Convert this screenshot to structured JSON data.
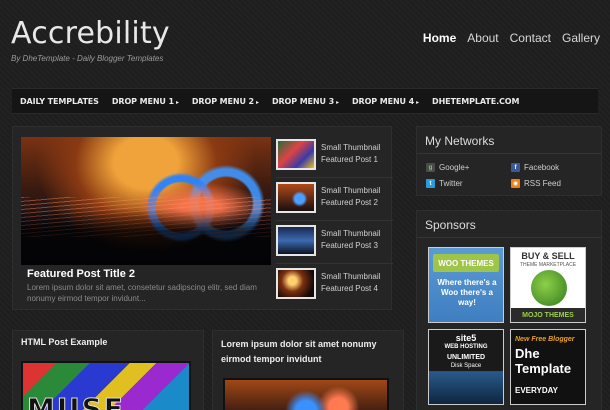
{
  "header": {
    "title": "Accrebility",
    "description": "By DheTemplate - Daily Blogger Templates",
    "nav": [
      "Home",
      "About",
      "Contact",
      "Gallery"
    ]
  },
  "menu": {
    "items": [
      {
        "label": "DAILY TEMPLATES",
        "dropdown": false
      },
      {
        "label": "DROP MENU 1",
        "dropdown": true
      },
      {
        "label": "DROP MENU 2",
        "dropdown": true
      },
      {
        "label": "DROP MENU 3",
        "dropdown": true
      },
      {
        "label": "DROP MENU 4",
        "dropdown": true
      },
      {
        "label": "DHETEMPLATE.COM",
        "dropdown": false
      }
    ],
    "arrow": "▸"
  },
  "featured": {
    "title": "Featured Post Title 2",
    "text": "Lorem ipsum dolor sit amet, consetetur sadipscing elitr, sed diam nonumy eirmod tempor invidunt...",
    "thumbs": [
      {
        "line1": "Small Thumbnail",
        "line2": "Featured Post 1"
      },
      {
        "line1": "Small Thumbnail",
        "line2": "Featured Post 2"
      },
      {
        "line1": "Small Thumbnail",
        "line2": "Featured Post 3"
      },
      {
        "line1": "Small Thumbnail",
        "line2": "Featured Post 4"
      }
    ]
  },
  "posts": {
    "html_title": "HTML Post Example",
    "html_image_text": "MUSE",
    "lorem_title": "Lorem ipsum dolor sit amet nonumy eirmod tempor invidunt"
  },
  "sidebar": {
    "networks_title": "My Networks",
    "networks": [
      {
        "label": "Google+",
        "icon": "google-plus-icon",
        "glyph": "g"
      },
      {
        "label": "Facebook",
        "icon": "facebook-icon",
        "glyph": "f"
      },
      {
        "label": "Twitter",
        "icon": "twitter-icon",
        "glyph": "t"
      },
      {
        "label": "RSS Feed",
        "icon": "rss-icon",
        "glyph": "◉"
      }
    ],
    "sponsors_title": "Sponsors",
    "ads": {
      "woo": {
        "brand": "WOO THEMES",
        "copy": "Where there's a Woo there's a way!"
      },
      "mojo": {
        "line1": "BUY & SELL",
        "line2": "THEME MARKETPLACE",
        "bottom": "MOJO THEMES"
      },
      "site5": {
        "logo": "site5",
        "l2": "WEB HOSTING",
        "l3": "UNLIMITED",
        "l4": "Disk Space"
      },
      "dhe": {
        "l1": "New Free Blogger",
        "l2": "Dhe Template",
        "l3": "EVERYDAY"
      }
    }
  },
  "colors": {
    "background": "#1e1e1e",
    "panel": "#252525",
    "text": "#cccccc"
  }
}
